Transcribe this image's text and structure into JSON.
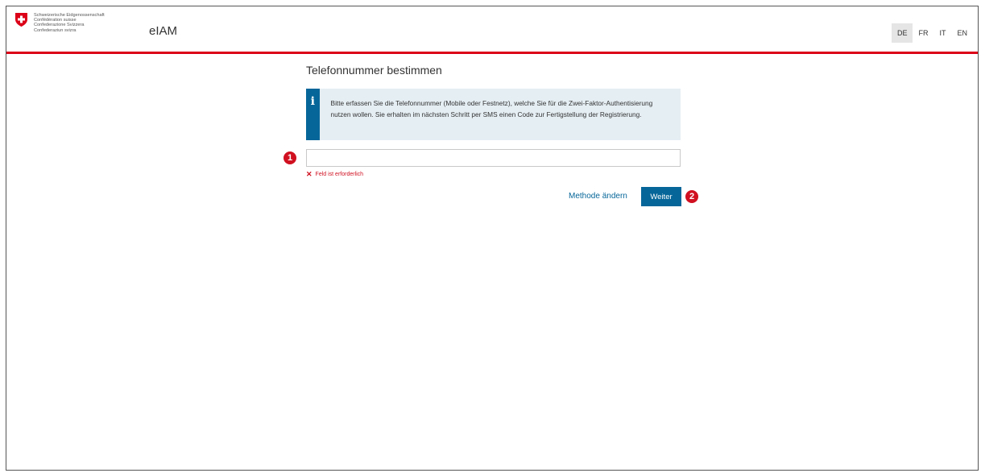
{
  "header": {
    "confederation_lines": [
      "Schweizerische Eidgenossenschaft",
      "Confédération suisse",
      "Confederazione Svizzera",
      "Confederaziun svizra"
    ],
    "app_name": "eIAM",
    "languages": [
      "DE",
      "FR",
      "IT",
      "EN"
    ],
    "active_language": "DE",
    "accent_color": "#dc0018"
  },
  "main": {
    "title": "Telefonnummer bestimmen",
    "info_icon": "info-icon",
    "info_text": "Bitte erfassen Sie die Telefonnummer (Mobile oder Festnetz), welche Sie für die Zwei-Faktor-Authentisierung nutzen wollen. Sie erhalten im nächsten Schritt per SMS einen Code zur Fertigstellung der Registrierung.",
    "phone_value": "",
    "error_text": "Feld ist erforderlich",
    "change_method_label": "Methode ändern",
    "next_label": "Weiter",
    "primary_color": "#066699",
    "error_color": "#d01020"
  },
  "annotations": {
    "marker1": "1",
    "marker2": "2"
  }
}
